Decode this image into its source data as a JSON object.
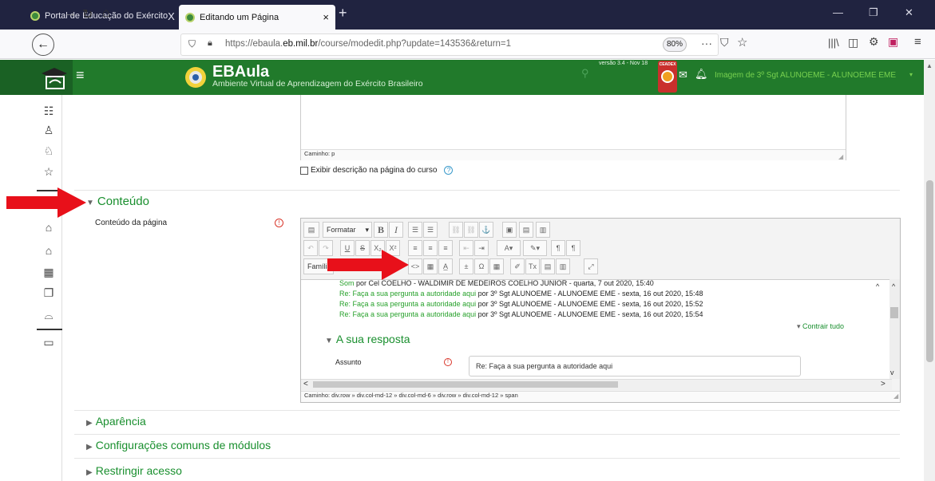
{
  "browser": {
    "tabs": [
      {
        "title": "Portal de Educação do Exército",
        "close": "X"
      },
      {
        "title": "Editando um Página",
        "close": "×"
      }
    ],
    "new_tab": "+",
    "url_domain_prefix": "https://ebaula.",
    "url_domain_bold": "eb.mil.br",
    "url_path": "/course/modedit.php?update=143536&return=1",
    "zoom": "80%"
  },
  "site": {
    "name": "EBAula",
    "subtitle": "Ambiente Virtual de Aprendizagem do Exército Brasileiro",
    "version": "versão 3.4 - Nov 18",
    "badge": "CEADEX",
    "user_link": "Imagem de 3º Sgt ALUNOEME - ALUNOEME EME"
  },
  "top_editor": {
    "path": "Caminho: p",
    "checkbox_label": "Exibir descrição na página do curso",
    "help_icon_char": "?"
  },
  "sections": {
    "conteudo": "Conteúdo",
    "conteudo_label": "Conteúdo da página",
    "required_char": "!",
    "aparencia": "Aparência",
    "config": "Configurações comuns de módulos",
    "restringir": "Restringir acesso"
  },
  "editor": {
    "format_label": "Formatar",
    "font_label": "Família",
    "posts": [
      {
        "title": "Som",
        "by": "por Cel COELHO - WALDIMIR DE MEDEIROS COELHO JUNIOR - quarta, 7 out 2020, 15:40"
      },
      {
        "title": "Re: Faça a sua pergunta a autoridade aqui",
        "by": "por 3º Sgt ALUNOEME - ALUNOEME EME - sexta, 16 out 2020, 15:48"
      },
      {
        "title": "Re: Faça a sua pergunta a autoridade aqui",
        "by": "por 3º Sgt ALUNOEME - ALUNOEME EME - sexta, 16 out 2020, 15:52"
      },
      {
        "title": "Re: Faça a sua pergunta a autoridade aqui",
        "by": "por 3º Sgt ALUNOEME - ALUNOEME EME - sexta, 16 out 2020, 15:54"
      }
    ],
    "contrair": "Contrair tudo",
    "sua_resposta": "A sua resposta",
    "assunto_label": "Assunto",
    "assunto_value": "Re: Faça a sua pergunta a autoridade aqui",
    "path": "Caminho: div.row » div.col-md-12 » div.col-md-6 » div.row » div.col-md-12 » span"
  },
  "colors": {
    "green": "#217a2b",
    "link_green": "#198f2e",
    "arrow_red": "#e8101a"
  }
}
